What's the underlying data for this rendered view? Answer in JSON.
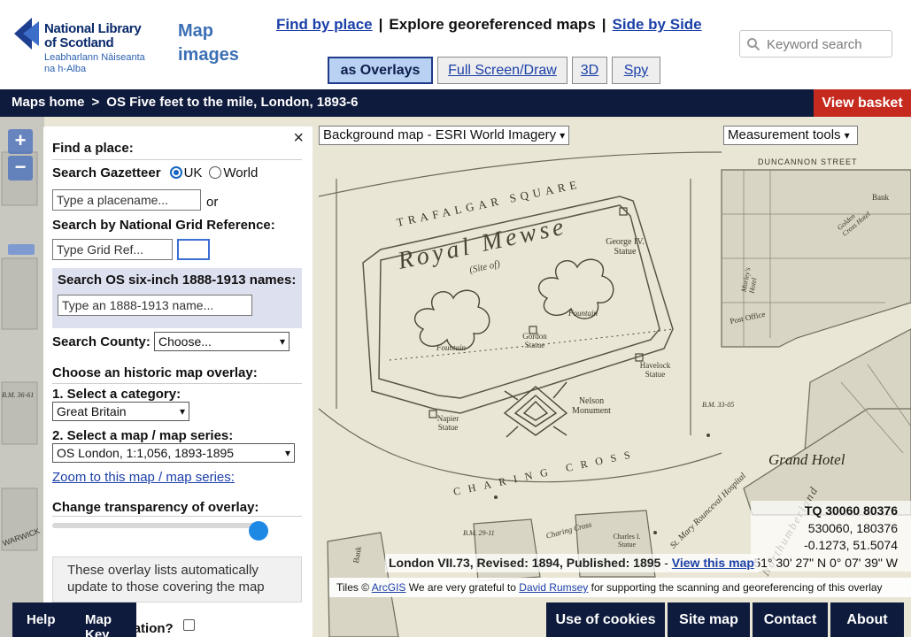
{
  "logo": {
    "line1": "National Library",
    "line2": "of Scotland",
    "line3": "Leabharlann Nàiseanta",
    "line4": "na h-Alba"
  },
  "app_title": "Map images",
  "nav": {
    "find_by_place": "Find by place",
    "separator": "|",
    "explore": "Explore georeferenced maps",
    "side_by_side": "Side by Side"
  },
  "modes": {
    "overlays": "as Overlays",
    "fullscreen": "Full Screen/Draw",
    "three_d": "3D",
    "spy": "Spy"
  },
  "search": {
    "placeholder": "Keyword search"
  },
  "breadcrumb": {
    "home": "Maps home",
    "sep": ">",
    "current": "OS Five feet to the mile, London, 1893-6"
  },
  "basket": "View basket",
  "map_controls": {
    "zoom_in": "+",
    "zoom_out": "−",
    "background": "Background map - ESRI World Imagery",
    "measure": "Measurement tools"
  },
  "panel": {
    "close": "×",
    "find_place": "Find a place:",
    "gazetteer": "Search Gazetteer",
    "uk": "UK",
    "world": "World",
    "placename_placeholder": "Type a placename...",
    "or": "or",
    "grid_heading": "Search by National Grid Reference:",
    "grid_placeholder": "Type Grid Ref...",
    "six_inch_heading": "Search OS six-inch 1888-1913 names:",
    "six_inch_placeholder": "Type an 1888-1913 name...",
    "county_label": "Search County:",
    "county_value": "Choose...",
    "overlay_heading": "Choose an historic map overlay:",
    "category_label": "1. Select a category:",
    "category_value": "Great Britain",
    "series_label": "2. Select a map / map series:",
    "series_value": "OS London, 1:1,056, 1893-1895",
    "zoom_link": "Zoom to this map / map series:",
    "transparency_label": "Change transparency of overlay:",
    "transparency_fraction": 0.97,
    "info": "These overlay lists automatically update to those covering the map",
    "location_label": "Show my location?"
  },
  "coords": {
    "tq": "TQ 30060 80376",
    "en": "530060, 180376",
    "lonlat": "-0.1273, 51.5074",
    "dms": "51° 30' 27\" N 0° 07' 39\" W"
  },
  "map_info": {
    "sheet": "London VII.73, Revised: 1894, Published: 1895",
    "dash": "-",
    "view_link": "View this map"
  },
  "attribution": {
    "tiles": "Tiles ©",
    "arcgis": "ArcGIS",
    "thanks": "We are very grateful to",
    "rumsey": "David Rumsey",
    "rest": "for supporting the scanning and georeferencing of this overlay"
  },
  "footer": {
    "help": "Help",
    "map_key": "Map Key",
    "cookies": "Use of cookies",
    "sitemap": "Site map",
    "contact": "Contact",
    "about": "About"
  },
  "map_text": {
    "trafalgar": "TRAFALGAR SQUARE",
    "royal_mews": "Royal Mewse",
    "site_of": "(Site of)",
    "george": "George IV. Statue",
    "fountain1": "Fountain",
    "fountain2": "Fountain",
    "gordon": "Gordon Statue",
    "havelock": "Havelock Statue",
    "nelson": "Nelson Monument",
    "napier": "Napier Statue",
    "charing": "CHARING CROSS",
    "grand_hotel": "Grand Hotel",
    "duncannon": "DUNCANNON STREET",
    "golden_cross": "Golden Cross Hotel",
    "morleys": "Morley's Hotel",
    "post_office": "Post Office",
    "bank": "Bank",
    "bank2": "Bank",
    "charing_cross2": "Charing Cross",
    "charles": "Charles I. Statue",
    "hospital": "St. Mary Rounceval Hospital",
    "northumberland": "Northumberland",
    "bm1": "B.M. 33-05",
    "bm2": "B.M. 29-11",
    "bm3": "B.M. 36-61",
    "warwick": "WARWICK"
  },
  "colors": {
    "navy": "#0e1b3c",
    "basket_red": "#c62a1f",
    "link_blue": "#1a3fa8",
    "map_paper": "#e7e4d3",
    "active_mode": "#b9d1f2"
  }
}
